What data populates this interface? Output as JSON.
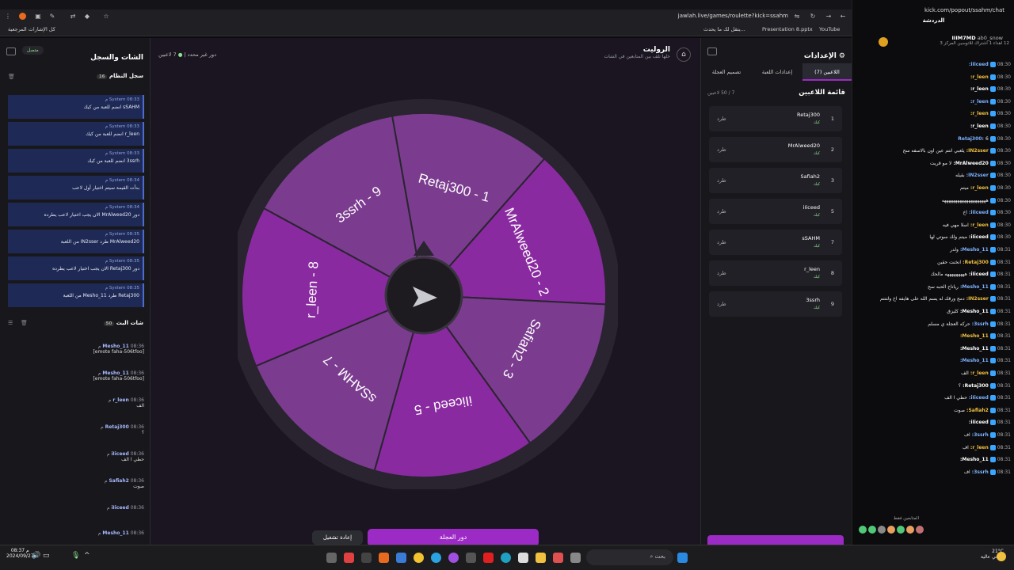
{
  "browser": {
    "url": "jawlah.live/games/roulette?kick=ssahm",
    "bookmarks": {
      "youtube": "YouTube",
      "presentation": "Presentation 8.pptx",
      "x_item": "يتقل لك ما يحدث...",
      "all_bookmarks": "كل الإشارات المرجعية"
    }
  },
  "app": {
    "header": {
      "title": "الروليت",
      "subtitle": "خلها تلف بين المتابعين في الشات",
      "players_count": "7 لاعبين",
      "round_info": "دور غير محدد"
    },
    "left_panel": {
      "title": "الشات والسجل",
      "status": "متصل",
      "log_title": "سجل النظام",
      "log_count": "16",
      "logs": [
        {
          "time": "08:33 م",
          "source": "System",
          "text": "sSAHM انضم للعبة من كيك"
        },
        {
          "time": "08:33 م",
          "source": "System",
          "text": "r_leen انضم للعبة من كيك"
        },
        {
          "time": "08:33 م",
          "source": "System",
          "text": "3ssrh انضم للعبة من كيك"
        },
        {
          "time": "08:34 م",
          "source": "System",
          "text": "بدأت القيمة سيتم اختيار أول لاعب"
        },
        {
          "time": "08:34 م",
          "source": "System",
          "text": "دور MrAlweed20 الان يجب اختيار لاعب يطرده"
        },
        {
          "time": "08:35 م",
          "source": "System",
          "text": "MrAlweed20 طرد IN2sser من اللعبة"
        },
        {
          "time": "08:35 م",
          "source": "System",
          "text": "دور Retaj300 الان يجب اختيار لاعب يطرده"
        },
        {
          "time": "08:35 م",
          "source": "System",
          "text": "Retaj300 طرد Mesho_11 من اللعبة"
        }
      ],
      "chat_title": "شات البث",
      "chat_count": "50",
      "chat": [
        {
          "time": "08:36 م",
          "name": "Mesho_11",
          "text": "[emote faha-506tfoo]"
        },
        {
          "time": "08:36 م",
          "name": "Mesho_11",
          "text": "[emote faha-506tfoo]"
        },
        {
          "time": "08:36 م",
          "name": "r_leen",
          "text": "الف"
        },
        {
          "time": "08:36 م",
          "name": "Retaj300",
          "text": "؟"
        },
        {
          "time": "08:36 م",
          "name": "iIiceed",
          "text": "حطي ا الف"
        },
        {
          "time": "08:36 م",
          "name": "Safiah2",
          "text": "صوت"
        },
        {
          "time": "08:36 م",
          "name": "iIiceed",
          "text": ""
        },
        {
          "time": "08:36 م",
          "name": "Mesho_11",
          "text": ""
        }
      ]
    },
    "wheel": {
      "segments": [
        {
          "label": "Retaj300 - 1",
          "color": "#7b3c8f"
        },
        {
          "label": "MrAlweed20 - 2",
          "color": "#8a2aa0"
        },
        {
          "label": "Safiah2 - 3",
          "color": "#7b3c8f"
        },
        {
          "label": "iIiceed - 5",
          "color": "#8a2aa0"
        },
        {
          "label": "sSAHM - 7",
          "color": "#7b3c8f"
        },
        {
          "label": "r_leen - 8",
          "color": "#8a2aa0"
        },
        {
          "label": "3ssrh - 9",
          "color": "#7b3c8f"
        }
      ],
      "spin_button": "دور العجلة",
      "reset_button": "إعادة تشغيل"
    },
    "right_panel": {
      "title": "الإعدادات",
      "tabs": [
        "اللاعبين (7)",
        "إعدادات اللعبة",
        "تصميم العجلة"
      ],
      "list_title": "قائمة اللاعبين",
      "list_count": "7 / 50 لاعبين",
      "kick_label": "طرد",
      "platform": "كيك",
      "players": [
        {
          "name": "Retaj300",
          "num": "1"
        },
        {
          "name": "MrAlweed20",
          "num": "2"
        },
        {
          "name": "Safiah2",
          "num": "3"
        },
        {
          "name": "iIiceed",
          "num": "5"
        },
        {
          "name": "sSAHM",
          "num": "7"
        },
        {
          "name": "r_leen",
          "num": "8"
        },
        {
          "name": "3ssrh",
          "num": "9"
        }
      ]
    }
  },
  "kick_chat": {
    "url": "kick.com/popout/ssahm/chat",
    "header": "الدردشة",
    "pinned_user": "IIIM7MD",
    "pinned_user2": "ab0_snow",
    "pinned_text": "12 اهداء 1 اشتراك للاتوسين المركز 3",
    "messages": [
      {
        "time": "08:30",
        "name": "iIiceed",
        "text": ""
      },
      {
        "time": "08:30",
        "name": "r_leen",
        "text": ""
      },
      {
        "time": "08:30",
        "name": "r_leen",
        "text": ""
      },
      {
        "time": "08:30",
        "name": "r_leen",
        "text": ""
      },
      {
        "time": "08:30",
        "name": "r_leen",
        "text": ""
      },
      {
        "time": "08:30",
        "name": "r_leen",
        "text": ""
      },
      {
        "time": "08:30",
        "name": "Retaj300",
        "text": "6"
      },
      {
        "time": "08:30",
        "name": "IN2sser",
        "text": "يلعبي انتم عين اون بالاسفه سح"
      },
      {
        "time": "08:30",
        "name": "MrAlweed20",
        "text": "لا مو قريت"
      },
      {
        "time": "08:30",
        "name": "IN2sser",
        "text": "بقيله"
      },
      {
        "time": "08:30",
        "name": "r_leen",
        "text": "ميتم"
      },
      {
        "time": "08:30",
        "name": "",
        "text": "ههههههههههههههههههههه"
      },
      {
        "time": "08:30",
        "name": "iIiceed",
        "text": "اخ"
      },
      {
        "time": "08:30",
        "name": "r_leen",
        "text": "اسلا مهي فيه"
      },
      {
        "time": "08:30",
        "name": "iIiceed",
        "text": "ميتم ولك سوتي لها"
      },
      {
        "time": "08:31",
        "name": "Mesho_11",
        "text": "ولدر"
      },
      {
        "time": "08:31",
        "name": "Retaj300",
        "text": "انخنت حقين"
      },
      {
        "time": "08:31",
        "name": "iIiceed",
        "text": "هههههههههه مالحك"
      },
      {
        "time": "08:31",
        "name": "Mesho_11",
        "text": "رياتاح الحبه سح"
      },
      {
        "time": "08:31",
        "name": "IN2sser",
        "text": "دمج ورقك له يسم الله على هايفه اخ ولتنتم"
      },
      {
        "time": "08:31",
        "name": "Mesho_11",
        "text": "كليزق"
      },
      {
        "time": "08:31",
        "name": "3ssrh",
        "text": "حركه العجلة ي مسلم"
      },
      {
        "time": "08:31",
        "name": "Mesho_11",
        "text": ""
      },
      {
        "time": "08:31",
        "name": "Mesho_11",
        "text": ""
      },
      {
        "time": "08:31",
        "name": "Mesho_11",
        "text": ""
      },
      {
        "time": "08:31",
        "name": "r_leen",
        "text": "الف"
      },
      {
        "time": "08:31",
        "name": "Retaj300",
        "text": "؟"
      },
      {
        "time": "08:31",
        "name": "iIiceed",
        "text": "حطي ا الف"
      },
      {
        "time": "08:31",
        "name": "Safiah2",
        "text": "صوت"
      },
      {
        "time": "08:31",
        "name": "iIiceed",
        "text": ""
      },
      {
        "time": "08:31",
        "name": "3ssrh",
        "text": "اف"
      },
      {
        "time": "08:31",
        "name": "r_leen",
        "text": "اف"
      },
      {
        "time": "08:31",
        "name": "Mesho_11",
        "text": ""
      },
      {
        "time": "08:31",
        "name": "3ssrh",
        "text": "اف"
      }
    ],
    "footer_label": "المتابعين فقط"
  },
  "taskbar": {
    "search": "بحث",
    "weather": "21°C",
    "weather_sub": "صافي عالية",
    "time": "08:37 م",
    "date": "2024/09/27"
  }
}
